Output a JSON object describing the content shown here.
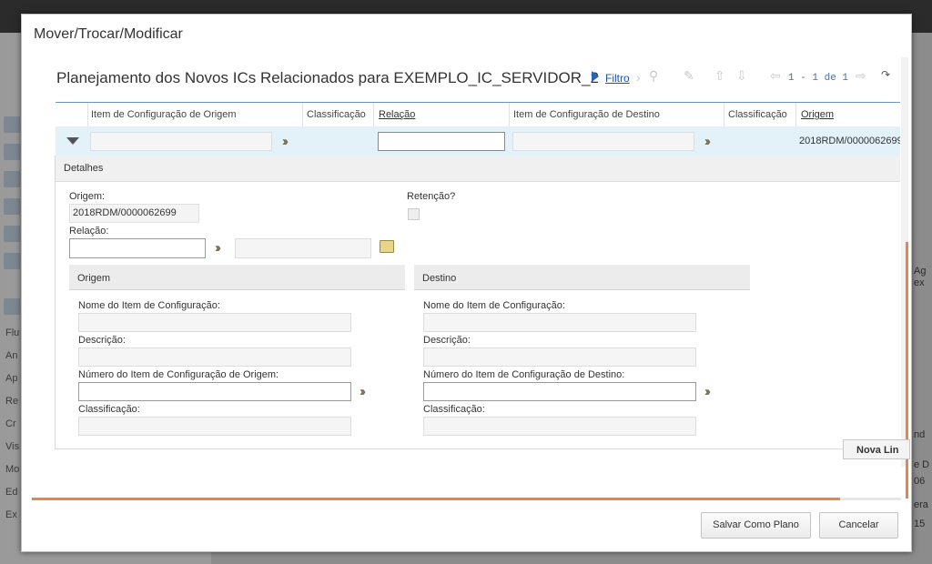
{
  "modal": {
    "title": "Mover/Trocar/Modificar"
  },
  "panel": {
    "title": "Planejamento dos Novos ICs Relacionados para EXEMPLO_IC_SERVIDOR_2",
    "filter_label": "Filtro",
    "pager_text": "1 - 1 de 1"
  },
  "grid": {
    "columns": [
      "Item de Configuração de Origem",
      "Classificação",
      "Relação",
      "Item de Configuração de Destino",
      "Classificação",
      "Origem"
    ],
    "row": {
      "origem": "2018RDM/0000062699"
    }
  },
  "details": {
    "title": "Detalhes",
    "origem_label": "Origem:",
    "origem_value": "2018RDM/0000062699",
    "retencao_label": "Retenção?",
    "relacao_label": "Relação:",
    "origem_section": {
      "title": "Origem",
      "nome_label": "Nome do Item de Configuração:",
      "descricao_label": "Descrição:",
      "numero_label": "Número do Item de Configuração de Origem:",
      "classificacao_label": "Classificação:"
    },
    "destino_section": {
      "title": "Destino",
      "nome_label": "Nome do Item de Configuração:",
      "descricao_label": "Descrição:",
      "numero_label": "Número do Item de Configuração de Destino:",
      "classificacao_label": "Classificação:"
    },
    "new_row_button": "Nova Lin"
  },
  "footer": {
    "save_plan_button": "Salvar Como Plano",
    "cancel_button": "Cancelar"
  },
  "progress": {
    "fraction": 0.93
  },
  "background": {
    "left_labels": [
      "Flu",
      "An",
      "Ap",
      "Re",
      "Cr",
      "Vis",
      "Mo",
      "Ed",
      "Ex"
    ],
    "right_texts": [
      "Ag",
      "ex",
      "nd",
      "e D",
      "06",
      "era",
      "15"
    ]
  },
  "colors": {
    "accent": "#e8844a",
    "link": "#1a55a8",
    "grid_row_bg": "#e3f1f8"
  },
  "icons": {
    "filter": "play-triangle-icon",
    "search": "magnifier-icon",
    "clear": "eraser-icon",
    "up": "arrow-up-icon",
    "down": "arrow-down-icon",
    "prev": "arrow-left-icon",
    "next": "arrow-right-icon",
    "export": "export-icon",
    "lookup": "double-chevron-icon",
    "new_relation": "card-add-icon"
  }
}
